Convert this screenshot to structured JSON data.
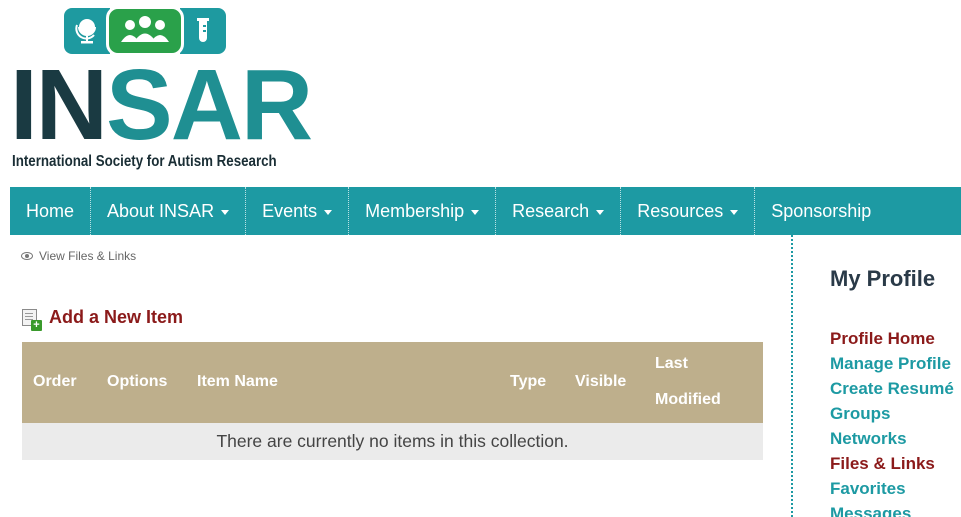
{
  "logo": {
    "icons": [
      "globe-icon",
      "people-icon",
      "test-tube-icon"
    ],
    "wordmark_dark": "IN",
    "wordmark_accent": "SAR",
    "tagline": "International Society for Autism Research",
    "colors": {
      "teal": "#1e9aa0",
      "green": "#2aa14a",
      "navy": "#1a3a42"
    }
  },
  "nav": {
    "color": "#1d9aa3",
    "items": [
      {
        "label": "Home",
        "dropdown": false
      },
      {
        "label": "About INSAR",
        "dropdown": true
      },
      {
        "label": "Events",
        "dropdown": true
      },
      {
        "label": "Membership",
        "dropdown": true
      },
      {
        "label": "Research",
        "dropdown": true
      },
      {
        "label": "Resources",
        "dropdown": true
      },
      {
        "label": "Sponsorship",
        "dropdown": false
      }
    ]
  },
  "breadcrumb": {
    "icon": "eye-icon",
    "label": "View Files & Links"
  },
  "add_item": {
    "icon": "add-document-icon",
    "label": "Add a New Item"
  },
  "table": {
    "header_color": "#beaf8c",
    "columns": [
      "Order",
      "Options",
      "Item Name",
      "Type",
      "Visible",
      "Last Modified"
    ],
    "last_modified_lines": [
      "Last",
      "Modified"
    ],
    "empty_message": "There are currently no items in this collection."
  },
  "sidebar": {
    "title": "My Profile",
    "items": [
      {
        "label": "Profile Home",
        "active": true
      },
      {
        "label": "Manage Profile",
        "active": false
      },
      {
        "label": "Create Resumé",
        "active": false
      },
      {
        "label": "Groups",
        "active": false
      },
      {
        "label": "Networks",
        "active": false
      },
      {
        "label": "Files & Links",
        "active": true
      },
      {
        "label": "Favorites",
        "active": false
      },
      {
        "label": "Messages",
        "active": false
      }
    ]
  }
}
